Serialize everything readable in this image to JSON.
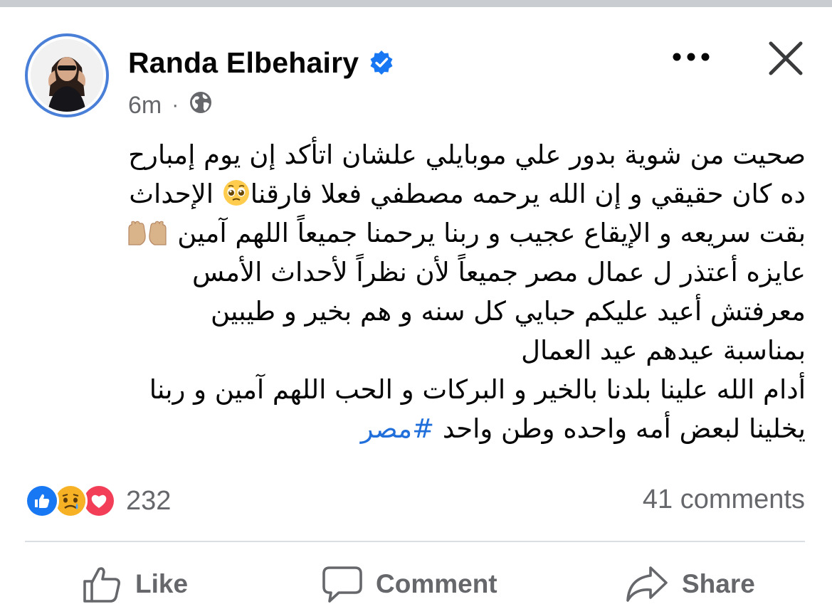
{
  "post": {
    "author_name": "Randa Elbehairy",
    "timestamp": "6m",
    "visibility_icon": "globe-icon",
    "verified_icon": "verified-badge-icon",
    "text_lines": [
      "صحيت من شوية بدور علي موبايلي علشان اتأكد إن يوم إمبارح",
      "ده كان حقيقي و إن الله يرحمه مصطفي فعلا فارقنا",
      "الإحداث بقت سريعه و الإيقاع عجيب و ربنا يرحمنا جميعاً اللهم آمين",
      "عايزه أعتذر ل عمال مصر جميعاً لأن نظراً لأحداث الأمس",
      "معرفتش أعيد عليكم حبايي كل سنه و هم بخير و طيبين",
      "بمناسبة عيدهم عيد العمال",
      "أدام الله علينا بلدنا بالخير و البركات و الحب اللهم آمين و ربنا",
      "يخلينا لبعض أمه واحده وطن واحد"
    ],
    "line3_part_a": "الإحداث",
    "line3_part_b": "بقت سريعه و الإيقاع عجيب و ربنا يرحمنا جميعاً اللهم آمين",
    "hashtag": "#مصر"
  },
  "reactions": {
    "icons": [
      "like-icon",
      "sad-icon",
      "love-icon"
    ],
    "count": "232"
  },
  "comments_label": "41 comments",
  "actions": {
    "like": "Like",
    "comment": "Comment",
    "share": "Share"
  },
  "colors": {
    "accent": "#1877f2",
    "hashtag": "#216fdb",
    "meta": "#65676b",
    "love": "#f33e58",
    "sad": "#f7b125"
  }
}
